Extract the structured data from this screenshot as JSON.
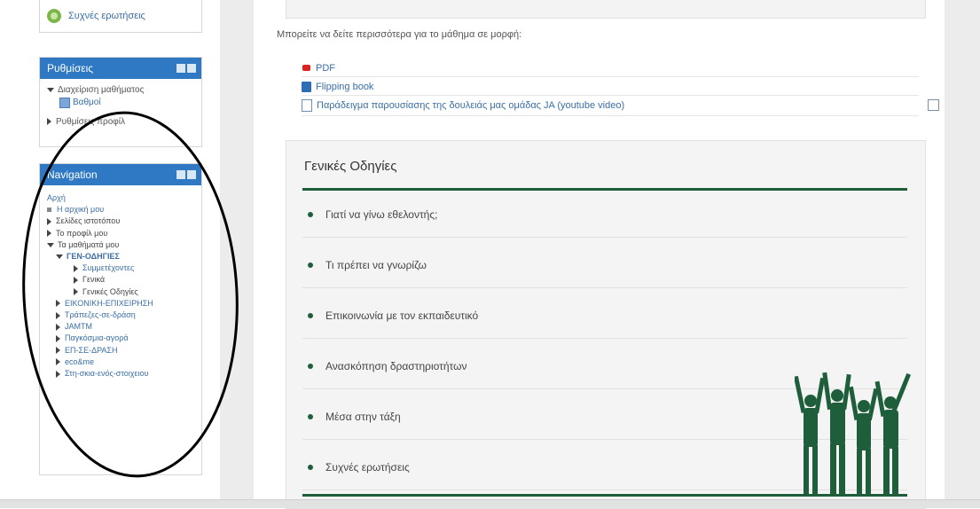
{
  "left": {
    "faq_link": "Συχνές ερωτήσεις",
    "settings": {
      "title": "Ρυθμίσεις",
      "course_admin": "Διαχείριση μαθήματος",
      "grades": "Βαθμοί",
      "profile_settings": "Ρυθμίσεις προφίλ"
    },
    "navigation": {
      "title": "Navigation",
      "home": "Αρχή",
      "my_home": "Η αρχική μου",
      "site_pages": "Σελίδες ιστοτόπου",
      "my_profile": "Το προφίλ μου",
      "my_courses": "Τα μαθήματά μου",
      "current_course": "ΓΕΝ-ΟΔΗΓΙΕΣ",
      "participants": "Συμμετέχοντες",
      "general": "Γενικά",
      "general_instructions": "Γενικές Οδηγίες",
      "courses": [
        "ΕΙΚΟΝΙΚΗ-ΕΠΙΧΕΙΡΗΣΗ",
        "Τράπεζες-σε-δράση",
        "JAMTM",
        "Παγκόσμια-αγορά",
        "ΕΠ-ΣΕ-ΔΡΑΣΗ",
        "eco&me",
        "Στη-σκια-ενός-στοιχειου"
      ]
    }
  },
  "main": {
    "intro_text": "Μπορείτε να δείτε περισσότερα για το μάθημα σε μορφή:",
    "links": {
      "pdf": "PDF",
      "flipping_book": "Flipping book",
      "example": "Παράδειγμα παρουσίασης της δουλειάς μας ομάδας JA (youtube video)"
    },
    "section_title": "Γενικές Οδηγίες",
    "topics": [
      "Γιατί να γίνω εθελοντής;",
      "Τι πρέπει να γνωρίζω",
      "Επικοινωνία με τον εκπαιδευτικό",
      "Ανασκόπηση δραστηριοτήτων",
      "Μέσα στην τάξη",
      "Συχνές ερωτήσεις"
    ]
  },
  "colors": {
    "accent_blue": "#2f78c4",
    "link_blue": "#3a6ea5",
    "dark_green": "#1e5e3a"
  }
}
